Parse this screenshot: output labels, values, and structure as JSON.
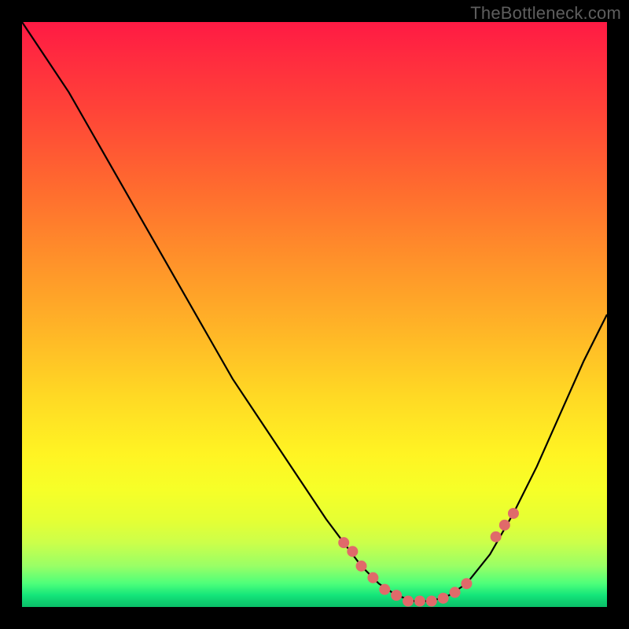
{
  "watermark": "TheBottleneck.com",
  "colors": {
    "page_bg": "#000000",
    "dot_fill": "#e06a6a",
    "curve_stroke": "#000000"
  },
  "chart_data": {
    "type": "line",
    "title": "",
    "xlabel": "",
    "ylabel": "",
    "xlim": [
      0,
      100
    ],
    "ylim": [
      0,
      100
    ],
    "series": [
      {
        "name": "bottleneck-curve",
        "x": [
          0,
          4,
          8,
          12,
          16,
          20,
          24,
          28,
          32,
          36,
          40,
          44,
          48,
          52,
          55,
          58,
          61,
          64,
          67,
          70,
          73,
          76,
          80,
          84,
          88,
          92,
          96,
          100
        ],
        "values": [
          100,
          94,
          88,
          81,
          74,
          67,
          60,
          53,
          46,
          39,
          33,
          27,
          21,
          15,
          11,
          7,
          4,
          2,
          1,
          1,
          2,
          4,
          9,
          16,
          24,
          33,
          42,
          50
        ]
      }
    ],
    "markers": {
      "name": "highlight-dots",
      "x": [
        55,
        56.5,
        58,
        60,
        62,
        64,
        66,
        68,
        70,
        72,
        74,
        76,
        81,
        82.5,
        84
      ],
      "values": [
        11,
        9.5,
        7,
        5,
        3,
        2,
        1,
        1,
        1,
        1.5,
        2.5,
        4,
        12,
        14,
        16
      ]
    }
  }
}
